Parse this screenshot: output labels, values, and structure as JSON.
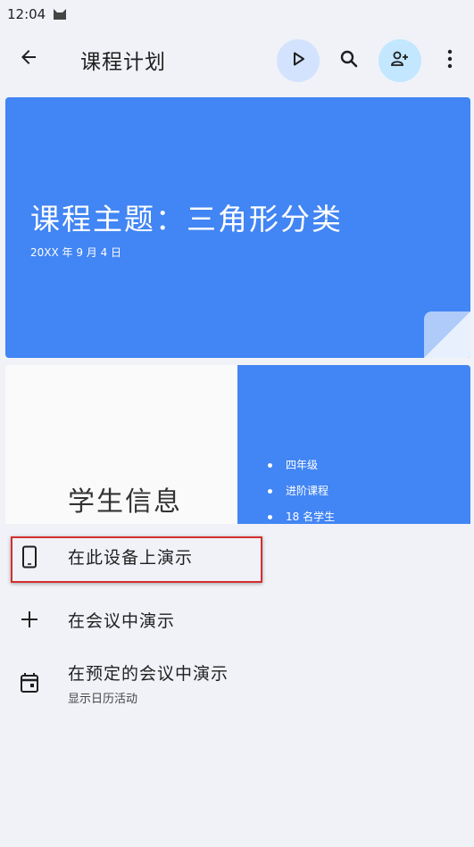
{
  "status_bar": {
    "time": "12:04",
    "notification_icon": "cat-icon"
  },
  "top_bar": {
    "title": "课程计划",
    "icons": {
      "back": "back-arrow-icon",
      "play": "play-icon",
      "search": "search-icon",
      "share": "add-person-icon",
      "more": "more-vert-icon"
    }
  },
  "slides": [
    {
      "title": "课程主题：三角形分类",
      "date": "20XX 年 9 月 4 日"
    },
    {
      "heading": "学生信息",
      "bullets": [
        "四年级",
        "进阶课程",
        "18 名学生"
      ]
    }
  ],
  "menu": [
    {
      "label": "在此设备上演示",
      "icon": "phone-icon"
    },
    {
      "label": "在会议中演示",
      "icon": "plus-icon"
    },
    {
      "label": "在预定的会议中演示",
      "sublabel": "显示日历活动",
      "icon": "calendar-icon"
    }
  ],
  "colors": {
    "accent": "#4285f4",
    "highlight": "#d32f2f",
    "play_bg": "#d3e3fd",
    "share_bg": "#c2e7ff"
  }
}
